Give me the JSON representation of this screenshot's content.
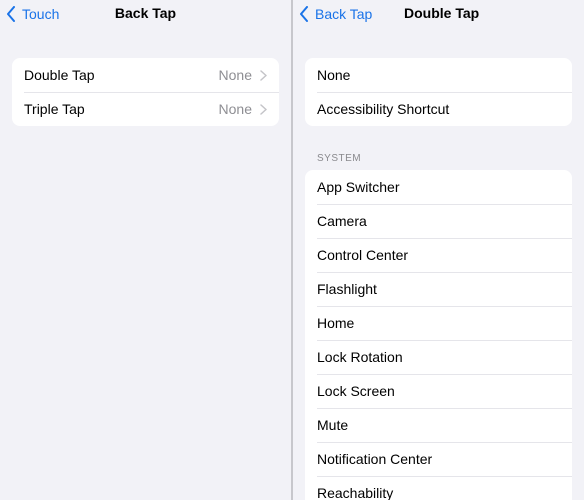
{
  "left": {
    "back_label": "Touch",
    "title": "Back Tap",
    "rows": [
      {
        "label": "Double Tap",
        "value": "None"
      },
      {
        "label": "Triple Tap",
        "value": "None"
      }
    ]
  },
  "right": {
    "back_label": "Back Tap",
    "title": "Double Tap",
    "top_rows": [
      {
        "label": "None"
      },
      {
        "label": "Accessibility Shortcut"
      }
    ],
    "section_header": "SYSTEM",
    "system_rows": [
      {
        "label": "App Switcher"
      },
      {
        "label": "Camera"
      },
      {
        "label": "Control Center"
      },
      {
        "label": "Flashlight"
      },
      {
        "label": "Home"
      },
      {
        "label": "Lock Rotation"
      },
      {
        "label": "Lock Screen"
      },
      {
        "label": "Mute"
      },
      {
        "label": "Notification Center"
      },
      {
        "label": "Reachability"
      }
    ]
  },
  "icons": {
    "back": "chevron-left-icon",
    "disclosure": "chevron-right-icon"
  },
  "colors": {
    "accent": "#1a73e8",
    "background": "#f2f2f7",
    "secondary_text": "#8e8e93"
  }
}
